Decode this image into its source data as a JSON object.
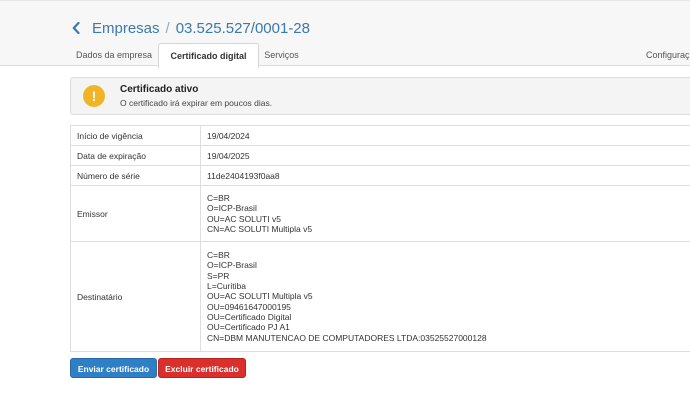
{
  "header": {
    "breadcrumb_parent": "Empresas",
    "breadcrumb_separator": "/",
    "breadcrumb_current": "03.525.527/0001-28"
  },
  "tabs": [
    {
      "label": "Dados da empresa",
      "active": false
    },
    {
      "label": "Certificado digital",
      "active": true
    },
    {
      "label": "Serviços",
      "active": false
    },
    {
      "label": "Configuraç",
      "active": false
    }
  ],
  "alert": {
    "icon": "exclamation-icon",
    "title": "Certificado ativo",
    "text": "O certificado irá expirar em poucos dias."
  },
  "details": {
    "inicio_label": "Início de vigência",
    "inicio_value": "19/04/2024",
    "expiracao_label": "Data de expiração",
    "expiracao_value": "19/04/2025",
    "serie_label": "Número de série",
    "serie_value": "11de2404193f0aa8",
    "emissor_label": "Emissor",
    "emissor_lines": [
      "C=BR",
      "O=ICP-Brasil",
      "OU=AC SOLUTI v5",
      "CN=AC SOLUTI Multipla v5"
    ],
    "destinatario_label": "Destinatário",
    "destinatario_lines": [
      "C=BR",
      "O=ICP-Brasil",
      "S=PR",
      "L=Curitiba",
      "OU=AC SOLUTI Multipla v5",
      "OU=09461647000195",
      "OU=Certificado Digital",
      "OU=Certificado PJ A1",
      "CN=DBM MANUTENCAO DE COMPUTADORES LTDA:03525527000128"
    ]
  },
  "actions": {
    "send_label": "Enviar certificado",
    "delete_label": "Excluir certificado"
  },
  "colors": {
    "link": "#3a79ad",
    "warning": "#f0b429",
    "primary": "#2f7fc4",
    "danger": "#d9302c"
  }
}
